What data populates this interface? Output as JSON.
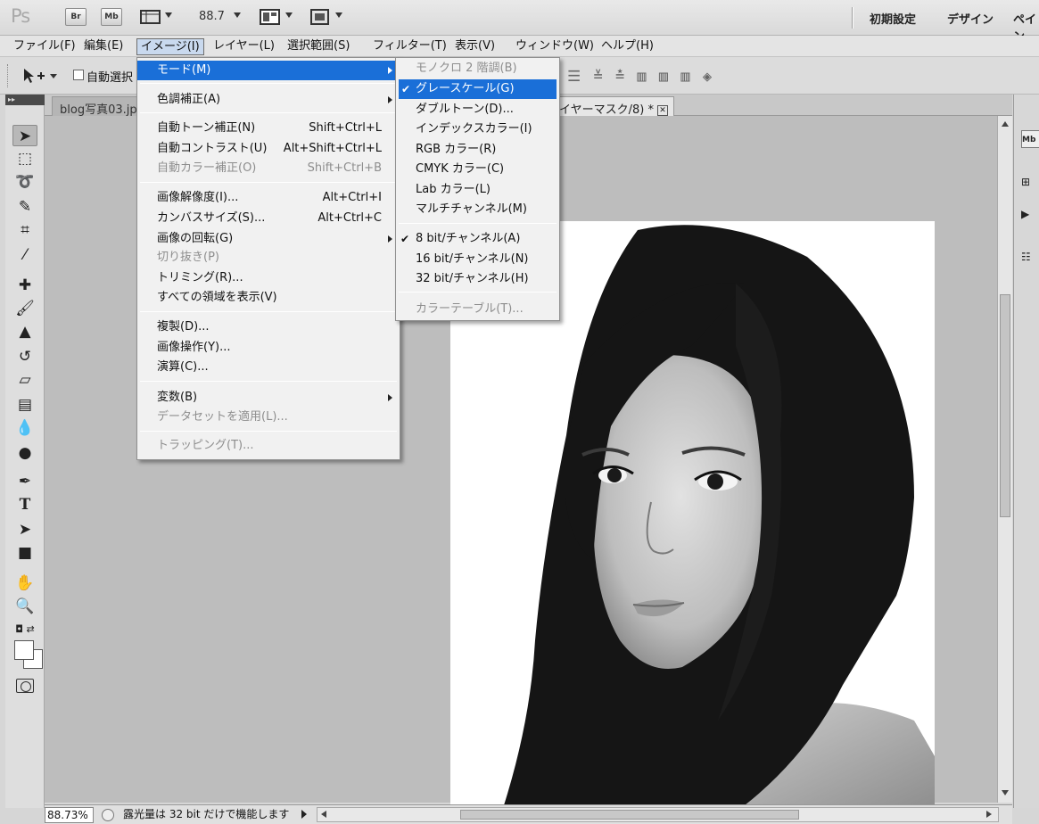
{
  "app": {
    "logo": "Ps",
    "buttons": {
      "bridge": "Br",
      "mini_bridge": "Mb"
    },
    "zoom_display": "88.7",
    "workspaces": [
      "初期設定",
      "デザイン",
      "ペイン"
    ]
  },
  "menubar": {
    "items": [
      "ファイル(F)",
      "編集(E)",
      "イメージ(I)",
      "レイヤー(L)",
      "選択範囲(S)",
      "フィルター(T)",
      "表示(V)",
      "ウィンドウ(W)",
      "ヘルプ(H)"
    ],
    "active_index": 2
  },
  "options": {
    "auto_select_label": "自動選択"
  },
  "documents": {
    "tab1": "blog写真03.jp",
    "tab2": "イヤーマスク/8) *",
    "close_glyph": "✕"
  },
  "image_menu": {
    "mode": "モード(M)",
    "adjustments": "色調補正(A)",
    "auto_tone": {
      "label": "自動トーン補正(N)",
      "shortcut": "Shift+Ctrl+L"
    },
    "auto_contrast": {
      "label": "自動コントラスト(U)",
      "shortcut": "Alt+Shift+Ctrl+L"
    },
    "auto_color": {
      "label": "自動カラー補正(O)",
      "shortcut": "Shift+Ctrl+B"
    },
    "image_size": {
      "label": "画像解像度(I)...",
      "shortcut": "Alt+Ctrl+I"
    },
    "canvas_size": {
      "label": "カンバスサイズ(S)...",
      "shortcut": "Alt+Ctrl+C"
    },
    "rotation": "画像の回転(G)",
    "crop": "切り抜き(P)",
    "trim": "トリミング(R)...",
    "reveal_all": "すべての領域を表示(V)",
    "duplicate": "複製(D)...",
    "apply_image": "画像操作(Y)...",
    "calculations": "演算(C)...",
    "variables": "変数(B)",
    "apply_data_set": "データセットを適用(L)...",
    "trap": "トラッピング(T)..."
  },
  "mode_submenu": {
    "bitmap": "モノクロ 2 階調(B)",
    "grayscale": "グレースケール(G)",
    "duotone": "ダブルトーン(D)...",
    "indexed": "インデックスカラー(I)",
    "rgb": "RGB カラー(R)",
    "cmyk": "CMYK カラー(C)",
    "lab": "Lab カラー(L)",
    "multichannel": "マルチチャンネル(M)",
    "bit8": "8 bit/チャンネル(A)",
    "bit16": "16 bit/チャンネル(N)",
    "bit32": "32 bit/チャンネル(H)",
    "color_table": "カラーテーブル(T)...",
    "check_glyph": "✔"
  },
  "status": {
    "zoom": "88.73%",
    "message": "露光量は 32 bit だけで機能します"
  },
  "colors": {
    "highlight": "#1a6fd8",
    "disabled_text": "#8d8d8d"
  }
}
